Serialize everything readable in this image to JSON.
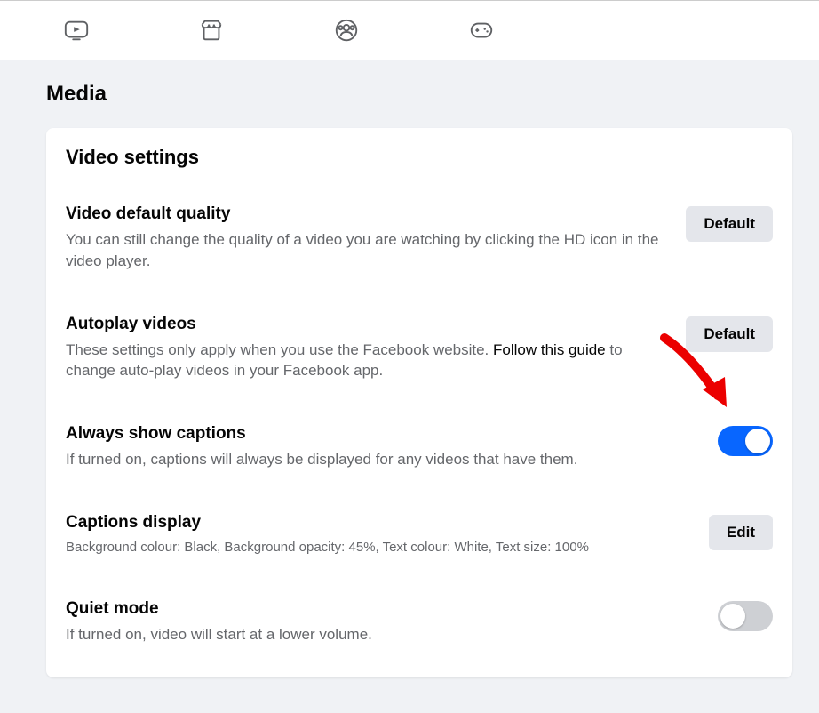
{
  "page": {
    "title": "Media"
  },
  "card": {
    "title": "Video settings"
  },
  "rows": {
    "quality": {
      "label": "Video default quality",
      "desc": "You can still change the quality of a video you are watching by clicking the HD icon in the video player.",
      "button": "Default"
    },
    "autoplay": {
      "label": "Autoplay videos",
      "desc_a": "These settings only apply when you use the Facebook website. ",
      "desc_link": "Follow this guide",
      "desc_b": " to change auto-play videos in your Facebook app.",
      "button": "Default"
    },
    "captions": {
      "label": "Always show captions",
      "desc": "If turned on, captions will always be displayed for any videos that have them."
    },
    "caption_display": {
      "label": "Captions display",
      "desc": "Background colour: Black, Background opacity: 45%, Text colour: White, Text size: 100%",
      "button": "Edit"
    },
    "quiet": {
      "label": "Quiet mode",
      "desc": "If turned on, video will start at a lower volume."
    }
  }
}
